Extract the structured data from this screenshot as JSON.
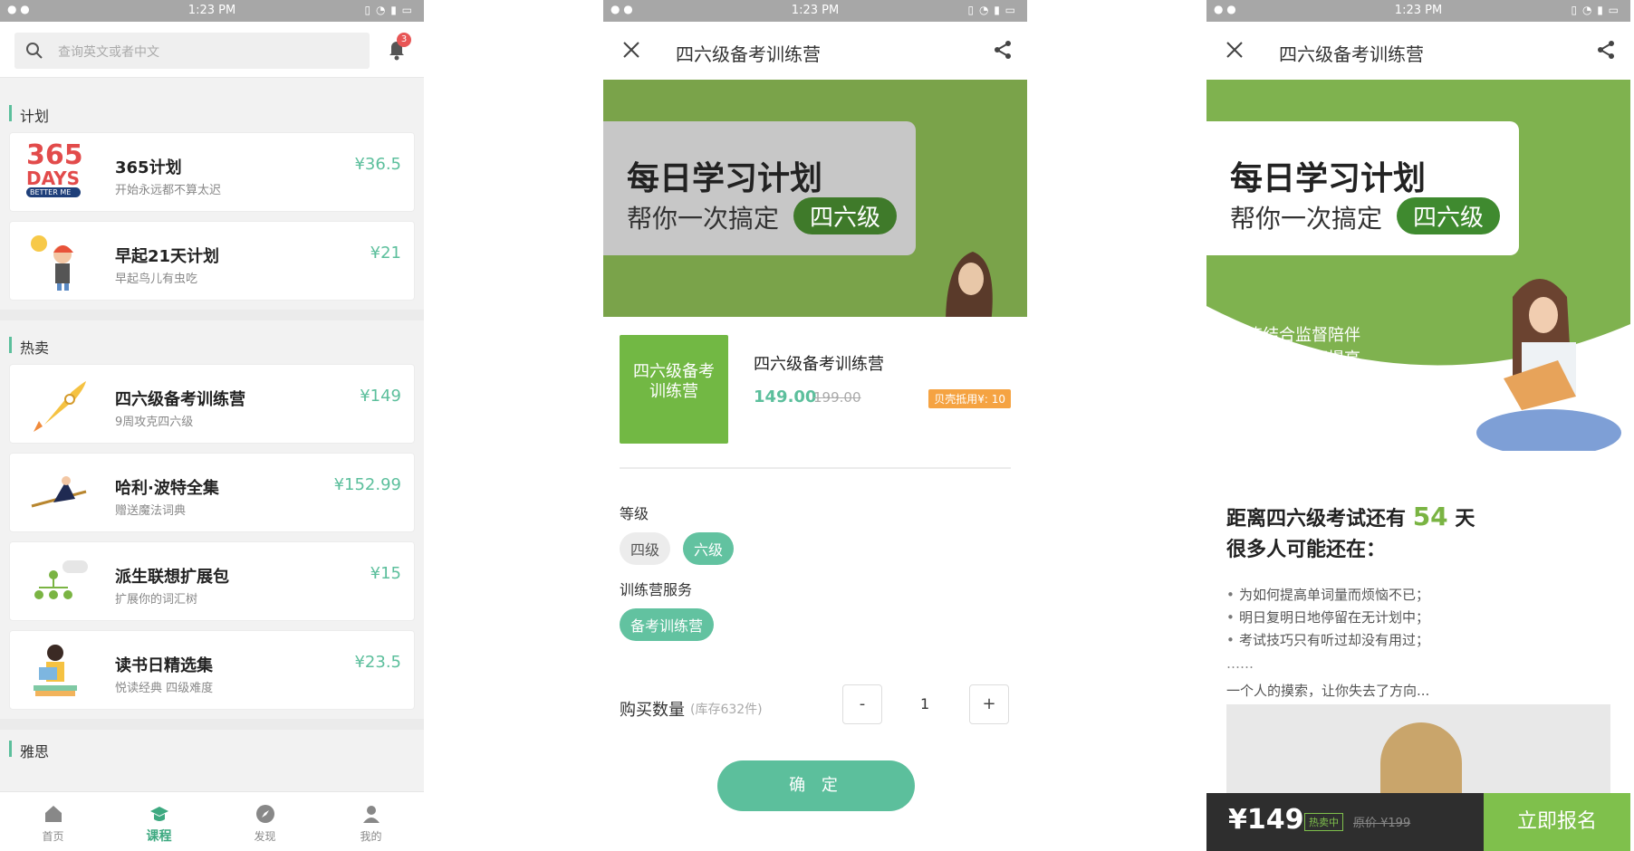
{
  "status": {
    "time": "1:23 PM"
  },
  "phone1": {
    "search_placeholder": "查询英文或者中文",
    "badge": "3",
    "sections": {
      "plan": "计划",
      "hot": "热卖",
      "ielts": "雅思"
    },
    "plan_items": [
      {
        "title": "365计划",
        "sub": "开始永远都不算太迟",
        "price": "¥36.5"
      },
      {
        "title": "早起21天计划",
        "sub": "早起鸟儿有虫吃",
        "price": "¥21"
      }
    ],
    "hot_items": [
      {
        "title": "四六级备考训练营",
        "sub": "9周攻克四六级",
        "price": "¥149"
      },
      {
        "title": "哈利·波特全集",
        "sub": "赠送魔法词典",
        "price": "¥152.99"
      },
      {
        "title": "派生联想扩展包",
        "sub": "扩展你的词汇树",
        "price": "¥15"
      },
      {
        "title": "读书日精选集",
        "sub": "悦读经典 四级难度",
        "price": "¥23.5"
      }
    ],
    "thumb_365": "365 DAYS",
    "tabs": [
      {
        "label": "首页",
        "icon": "home-icon"
      },
      {
        "label": "课程",
        "icon": "course-icon"
      },
      {
        "label": "发现",
        "icon": "compass-icon"
      },
      {
        "label": "我的",
        "icon": "user-icon"
      }
    ]
  },
  "phone2": {
    "title": "四六级备考训练营",
    "banner_big": "每日学习计划",
    "banner_mid": "帮你一次搞定",
    "banner_pill": "四六级",
    "product_img_text": "四六级备考训练营",
    "product_name": "四六级备考训练营",
    "price": "149.00",
    "old_price": "199.00",
    "discount_tag": "贝壳抵用¥: 10",
    "level_label": "等级",
    "levels": [
      "四级",
      "六级"
    ],
    "service_label": "训练营服务",
    "service": "备考训练营",
    "qty_label": "购买数量",
    "stock": "(库存632件)",
    "minus": "-",
    "plus": "+",
    "qty": "1",
    "confirm": "确 定"
  },
  "phone3": {
    "title": "四六级备考训练营",
    "banner_big": "每日学习计划",
    "banner_mid": "帮你一次搞定",
    "banner_pill": "四六级",
    "slogan1": "学练结合监督陪伴",
    "slogan2": "听读写译全面提高",
    "count_prefix": "距离四六级考试还有",
    "count_num": "54",
    "count_suffix": "天",
    "line2": "很多人可能还在：",
    "bullets": [
      "为如何提高单词量而烦恼不已；",
      "明日复明日地停留在无计划中；",
      "考试技巧只有听过却没有用过；"
    ],
    "dots": "……",
    "last": "一个人的摸索，让你失去了方向...",
    "footer_price": "¥149",
    "footer_hot": "热卖中",
    "footer_old": "原价 ¥199",
    "footer_btn": "立即报名"
  },
  "colors": {
    "accent": "#5cbf9c",
    "green": "#7fb24f",
    "orange": "#f5a342"
  }
}
